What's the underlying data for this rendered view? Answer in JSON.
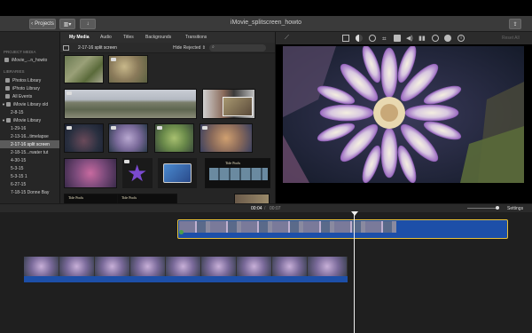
{
  "window": {
    "title": "iMovie_splitscreen_howto",
    "back_label": "Projects"
  },
  "sidebar": {
    "project_media_header": "PROJECT MEDIA",
    "project_item": "iMovie_...n_howto",
    "libraries_header": "LIBRARIES",
    "items": [
      {
        "label": "Photos Library"
      },
      {
        "label": "iPhoto Library"
      },
      {
        "label": "All Events"
      },
      {
        "label": "iMovie Library old"
      },
      {
        "label": "2-8-15"
      },
      {
        "label": "iMovie Library"
      },
      {
        "label": "1-29-16"
      },
      {
        "label": "2-13-16...timelapse"
      },
      {
        "label": "2-17-16 split screen"
      },
      {
        "label": "2-18-15...rwater tut"
      },
      {
        "label": "4-30-15"
      },
      {
        "label": "5-3-15"
      },
      {
        "label": "5-3-15 1"
      },
      {
        "label": "6-27-15"
      },
      {
        "label": "7-18-15 Donne Bay"
      }
    ],
    "selected_index": 8
  },
  "browser": {
    "tabs": [
      "My Media",
      "Audio",
      "Titles",
      "Backgrounds",
      "Transitions"
    ],
    "selected_tab": "My Media",
    "event_name": "2-17-16 split screen",
    "filter_label": "Hide Rejected",
    "tide_pools_label_1": "Tide Pools",
    "tide_pools_label_2": "Tide Pools",
    "tide_pools_label_3": "Tide Pools"
  },
  "viewer": {
    "reset_all_label": "Reset All"
  },
  "timeline": {
    "current_time": "00:04",
    "separator": "/",
    "total_time": "00:07",
    "settings_label": "Settings"
  },
  "colors": {
    "selection_yellow": "#e8c23a",
    "clip_blue": "#1d4fa8",
    "accent_purple": "#b58ad0"
  },
  "icons": [
    "projects-back-icon",
    "library-toggle-icon",
    "import-icon",
    "share-icon",
    "magic-wand-icon",
    "search-icon",
    "crop-icon",
    "color-icon",
    "speaker-icon",
    "speed-icon",
    "info-icon"
  ]
}
